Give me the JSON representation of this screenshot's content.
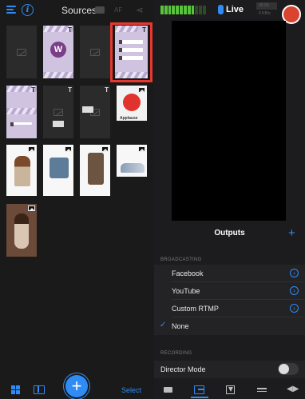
{
  "sources": {
    "title": "Sources",
    "af_label": "AF",
    "select_label": "Select",
    "add_label": "+",
    "thumbs": {
      "t_badge": "T",
      "w_letter": "W",
      "apple_label": "Applause"
    }
  },
  "live": {
    "label": "Live",
    "stats_line1": "00:00",
    "stats_line2": "0 KB/s"
  },
  "outputs": {
    "title": "Outputs",
    "add_label": "+",
    "broadcasting_label": "BROADCASTING",
    "rows": [
      {
        "label": "Facebook"
      },
      {
        "label": "YouTube"
      },
      {
        "label": "Custom RTMP"
      },
      {
        "label": "None",
        "selected": true
      }
    ],
    "recording_label": "RECORDING",
    "director_mode_label": "Director Mode",
    "director_mode_on": false
  },
  "icons": {
    "check": "✓",
    "chevron": "›",
    "audio": "◀▶"
  },
  "colors": {
    "accent": "#2f8cf5",
    "record": "#d9432f",
    "highlight": "#e7382f",
    "meter_on": "#58c43a"
  }
}
